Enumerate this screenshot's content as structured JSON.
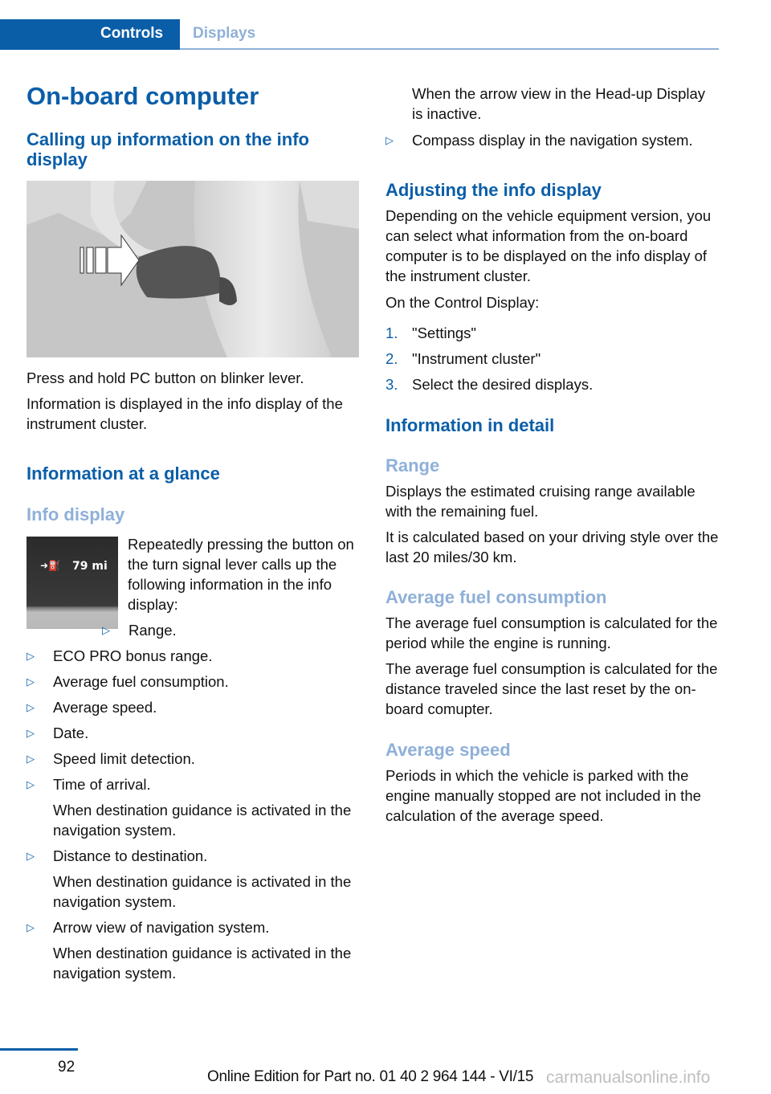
{
  "header": {
    "tabs": [
      {
        "label": "Controls",
        "active": true
      },
      {
        "label": "Displays",
        "active": false
      }
    ]
  },
  "colors": {
    "accent": "#0a5ea8",
    "accent_light": "#8fb0d8",
    "text": "#111111"
  },
  "left": {
    "title": "On-board computer",
    "section1_heading": "Calling up information on the info display",
    "figure1_alt": "Blinker lever with arrow pointing at PC button",
    "p1": "Press and hold PC button on blinker lever.",
    "p2": "Information is displayed in the info display of the instrument cluster.",
    "section2_heading": "Information at a glance",
    "subheading": "Info display",
    "figure2": {
      "icon": "fuel-range-icon",
      "value": "79 mi"
    },
    "intro": "Repeatedly pressing the button on the turn signal lever calls up the following information in the info display:",
    "bullets": [
      {
        "text": "Range."
      },
      {
        "text": "ECO PRO bonus range."
      },
      {
        "text": "Average fuel consumption."
      },
      {
        "text": "Average speed."
      },
      {
        "text": "Date."
      },
      {
        "text": "Speed limit detection."
      },
      {
        "text": "Time of arrival.",
        "note": "When destination guidance is activated in the navigation system."
      },
      {
        "text": "Distance to destination.",
        "note": "When destination guidance is activated in the navigation system."
      },
      {
        "text": "Arrow view of navigation system.",
        "note": "When destination guidance is activated in the navigation system."
      }
    ]
  },
  "right": {
    "continued_note": "When the arrow view in the Head-up Display is inactive.",
    "bullet_compass": "Compass display in the navigation system.",
    "adjust_heading": "Adjusting the info display",
    "adjust_p1": "Depending on the vehicle equipment version, you can select what information from the on-board computer is to be displayed on the info display of the instrument cluster.",
    "adjust_p2": "On the Control Display:",
    "steps": [
      {
        "num": "1.",
        "text": "\"Settings\""
      },
      {
        "num": "2.",
        "text": "\"Instrument cluster\""
      },
      {
        "num": "3.",
        "text": "Select the desired displays."
      }
    ],
    "detail_heading": "Information in detail",
    "range_heading": "Range",
    "range_p1": "Displays the estimated cruising range available with the remaining fuel.",
    "range_p2": "It is calculated based on your driving style over the last 20 miles/30 km.",
    "fuel_heading": "Average fuel consumption",
    "fuel_p1": "The average fuel consumption is calculated for the period while the engine is running.",
    "fuel_p2": "The average fuel consumption is calculated for the distance traveled since the last reset by the on-board comupter.",
    "speed_heading": "Average speed",
    "speed_p1": "Periods in which the vehicle is parked with the engine manually stopped are not included in the calculation of the average speed."
  },
  "footer": {
    "page_number": "92",
    "edition": "Online Edition for Part no. 01 40 2 964 144 - VI/15",
    "watermark": "carmanualsonline.info"
  }
}
